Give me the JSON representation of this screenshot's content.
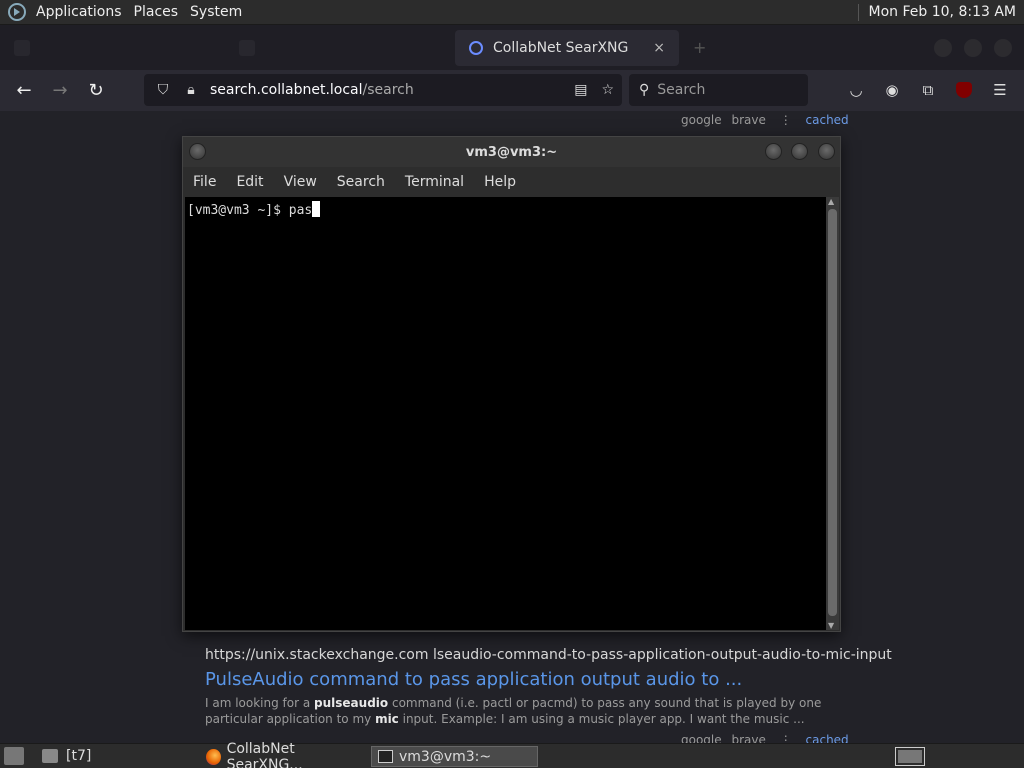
{
  "top_panel": {
    "menus": [
      "Applications",
      "Places",
      "System"
    ],
    "clock": "Mon Feb 10,  8:13 AM"
  },
  "browser": {
    "active_tab_title": "CollabNet SearXNG",
    "close_glyph": "×",
    "new_tab_glyph": "+",
    "url": {
      "host": "search.collabnet.local",
      "path": "/search"
    },
    "search_placeholder": "Search"
  },
  "page": {
    "top_links": {
      "engines": [
        "google",
        "brave"
      ],
      "cached": "cached"
    },
    "result": {
      "url": "https://unix.stackexchange.com  lseaudio-command-to-pass-application-output-audio-to-mic-input",
      "title": "PulseAudio command to pass application output audio to ...",
      "snippet": {
        "t1": "I am looking for a ",
        "b1": "pulseaudio",
        "t2": " command (i.e. pactl or pacmd) to pass any sound that is played by one particular application to my ",
        "b2": "mic",
        "t3": " input. Example: I am using a music player app. I want the music ..."
      },
      "links": {
        "engines": [
          "google",
          "brave"
        ],
        "cached": "cached"
      }
    }
  },
  "terminal": {
    "title": "vm3@vm3:~",
    "menu": [
      "File",
      "Edit",
      "View",
      "Search",
      "Terminal",
      "Help"
    ],
    "prompt": "[vm3@vm3 ~]$ ",
    "typed": "pas"
  },
  "bottom_panel": {
    "tasks": {
      "t7": "[t7]",
      "firefox": "CollabNet SearXNG...",
      "terminal": "vm3@vm3:~"
    }
  }
}
